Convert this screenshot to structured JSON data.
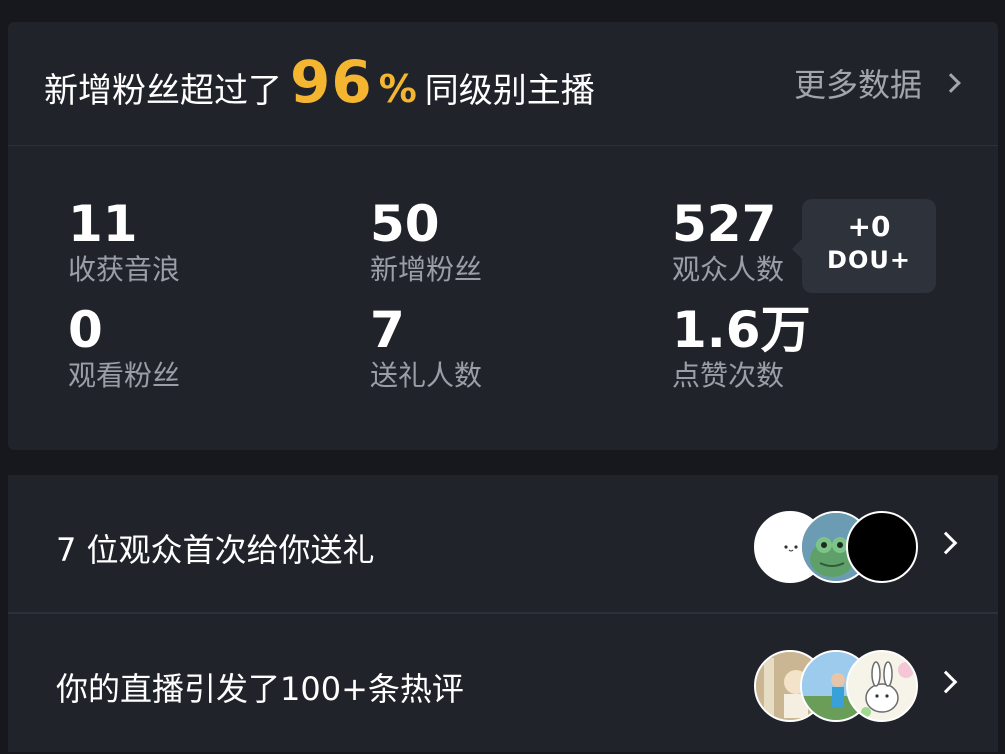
{
  "header": {
    "prefix": "新增粉丝超过了",
    "percent": "96",
    "percent_symbol": "%",
    "suffix": "同级别主播",
    "more_label": "更多数据"
  },
  "stats": [
    {
      "value": "11",
      "label": "收获音浪"
    },
    {
      "value": "50",
      "label": "新增粉丝"
    },
    {
      "value": "527",
      "label": "观众人数"
    },
    {
      "value": "0",
      "label": "观看粉丝"
    },
    {
      "value": "7",
      "label": "送礼人数"
    },
    {
      "value": "1.6万",
      "label": "点赞次数"
    }
  ],
  "dou_badge": {
    "delta": "+0",
    "label": "DOU+"
  },
  "rows": [
    {
      "text": "7 位观众首次给你送礼"
    },
    {
      "text": "你的直播引发了100+条热评"
    }
  ]
}
